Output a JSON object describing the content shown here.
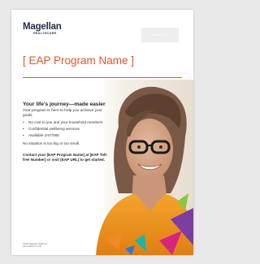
{
  "header": {
    "logo_text": "Magellan",
    "logo_subtext": "HEALTHCARE.",
    "cobrand_label": "Customer logo"
  },
  "program": {
    "title": "[ EAP Program Name ]"
  },
  "content": {
    "headline": "Your life’s journey—made easier",
    "intro": "Your program is here to help you achieve your goals",
    "benefits": [
      "No cost to you and your household members",
      "Confidential wellbeing services",
      "Available 24/7/365"
    ],
    "bullet": "•",
    "tagline": "No situation is too big or too small.",
    "cta": "Contact your [EAP Program Name] at [EAP Toll-free Number] or visit [EAP URL] to get started."
  },
  "footer": {
    "copyright": "©2022 Magellan Health Inc.",
    "code": "(Ch-ln-ENG-xx-1-22)"
  },
  "colors": {
    "accent": "#e8542a",
    "brand_navy": "#1f2a44",
    "triangle_orange": "#f08a24",
    "triangle_teal": "#1fb3a6",
    "triangle_purple": "#7a3fa1",
    "triangle_magenta": "#d6267c",
    "triangle_green": "#8cc63f",
    "triangle_blue": "#2b7bd0"
  }
}
